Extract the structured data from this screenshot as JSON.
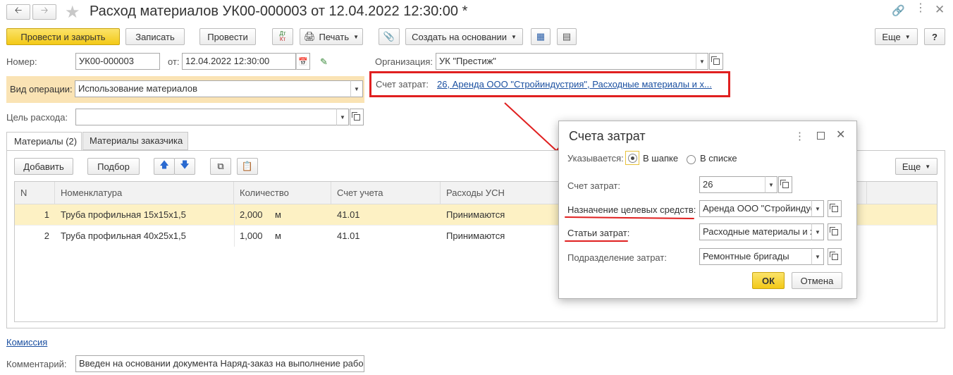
{
  "window": {
    "title": "Расход материалов УК00-000003 от 12.04.2022 12:30:00 *"
  },
  "toolbar": {
    "post_close": "Провести и закрыть",
    "save": "Записать",
    "post": "Провести",
    "dt_kt": "Дт Кт",
    "print": "Печать",
    "create_based": "Создать на основании",
    "more": "Еще",
    "help": "?"
  },
  "header": {
    "number_label": "Номер:",
    "number_value": "УК00-000003",
    "date_label": "от:",
    "date_value": "12.04.2022 12:30:00",
    "org_label": "Организация:",
    "org_value": "УК \"Престиж\"",
    "op_label": "Вид операции:",
    "op_value": "Использование материалов",
    "cost_account_label": "Счет затрат:",
    "cost_account_link": "26, Аренда ООО \"Стройиндустрия\", Расходные материалы и х...",
    "purpose_label": "Цель расхода:",
    "purpose_value": ""
  },
  "tabs": [
    {
      "label": "Материалы (2)"
    },
    {
      "label": "Материалы заказчика"
    }
  ],
  "table_toolbar": {
    "add": "Добавить",
    "pick": "Подбор",
    "more": "Еще"
  },
  "table": {
    "columns": [
      "N",
      "Номенклатура",
      "Количество",
      "Счет учета",
      "Расходы УСН"
    ],
    "rows": [
      {
        "n": "1",
        "name": "Труба профильная 15х15х1,5",
        "qty": "2,000",
        "unit": "м",
        "account": "41.01",
        "usn": "Принимаются"
      },
      {
        "n": "2",
        "name": "Труба профильная 40х25х1,5",
        "qty": "1,000",
        "unit": "м",
        "account": "41.01",
        "usn": "Принимаются"
      }
    ]
  },
  "footer": {
    "commission_link": "Комиссия",
    "comment_label": "Комментарий:",
    "comment_value": "Введен на основании документа Наряд-заказ на выполнение рабо"
  },
  "dialog": {
    "title": "Счета затрат",
    "indicated_label": "Указывается:",
    "option_header": "В шапке",
    "option_list": "В списке",
    "cost_account_label": "Счет затрат:",
    "cost_account_value": "26",
    "purpose_label": "Назначение целевых средств:",
    "purpose_value": "Аренда ООО \"Стройиндус",
    "articles_label": "Статьи затрат:",
    "articles_value": "Расходные материалы и х",
    "division_label": "Подразделение затрат:",
    "division_value": "Ремонтные бригады",
    "ok": "ОК",
    "cancel": "Отмена"
  },
  "colors": {
    "accent_yellow": "#f3c917",
    "highlight_red": "#e02020",
    "row_selected": "#fdf1c4",
    "link_blue": "#1a4fa0"
  }
}
